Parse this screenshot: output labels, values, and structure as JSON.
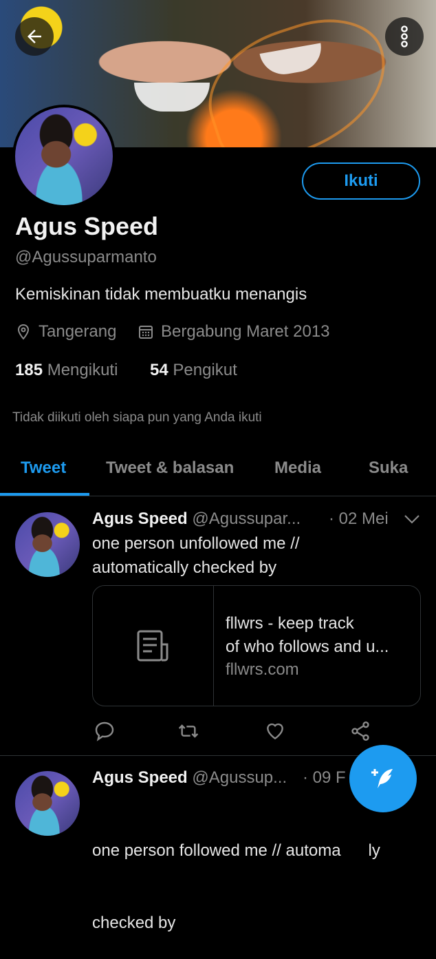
{
  "profile": {
    "name": "Agus Speed",
    "handle": "@Agussuparmanto",
    "bio": "Kemiskinan tidak membuatku menangis",
    "location": "Tangerang",
    "joined": "Bergabung Maret 2013",
    "following_count": "185",
    "following_label": "Mengikuti",
    "followers_count": "54",
    "followers_label": "Pengikut",
    "not_followed_text": "Tidak diikuti oleh siapa pun yang Anda ikuti"
  },
  "header": {
    "back_icon": "arrow-left-icon",
    "more_icon": "more-vertical-icon",
    "follow_label": "Ikuti"
  },
  "tabs": [
    {
      "label": "Tweet",
      "active": true
    },
    {
      "label": "Tweet & balasan",
      "active": false
    },
    {
      "label": "Media",
      "active": false
    },
    {
      "label": "Suka",
      "active": false
    }
  ],
  "tweets": [
    {
      "author": "Agus Speed",
      "handle": "@Agussupar...",
      "date": "· 02 Mei",
      "text_lines": [
        "one person unfollowed me //",
        "automatically checked by"
      ],
      "card": {
        "title_lines": [
          "fllwrs - keep track",
          "of who follows and u..."
        ],
        "domain": "fllwrs.com"
      }
    },
    {
      "author": "Agus Speed",
      "handle": "@Agussup...",
      "date": "· 09 F",
      "text_lines": [
        "one person followed me // automa      ly",
        "checked by"
      ]
    }
  ],
  "colors": {
    "accent": "#1d9bf0",
    "background": "#000000",
    "muted": "#8b8b8b"
  }
}
